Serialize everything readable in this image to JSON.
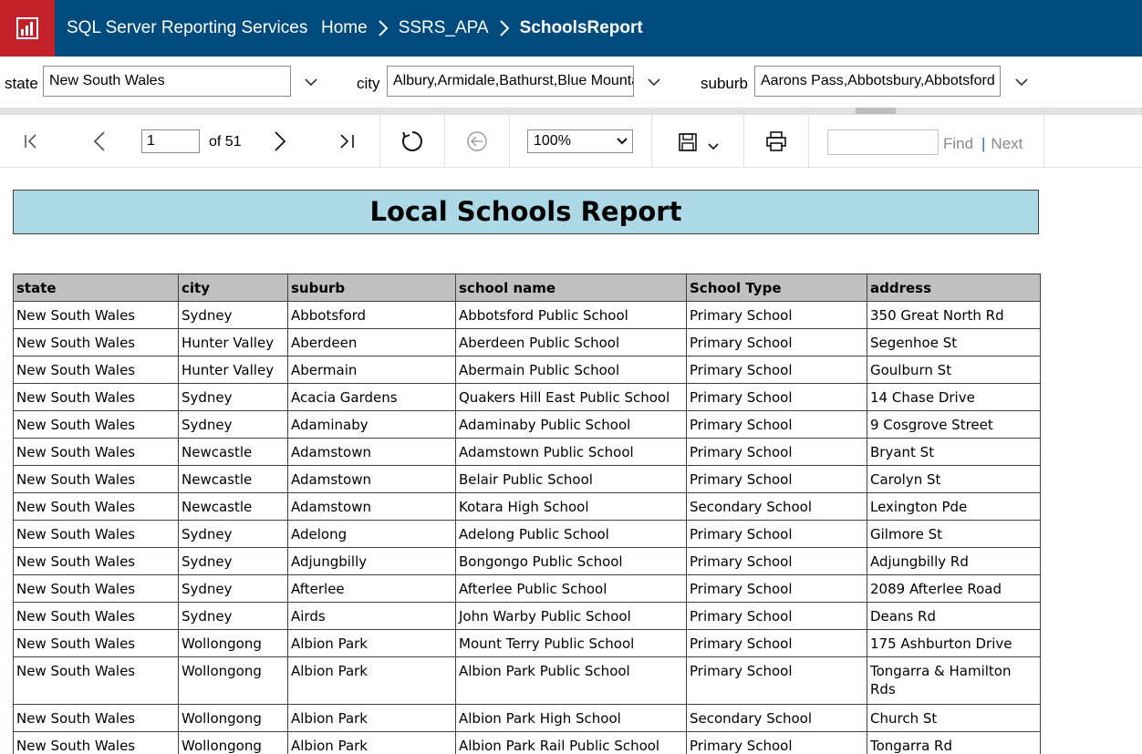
{
  "header": {
    "app_title": "SQL Server Reporting Services",
    "breadcrumbs": [
      "Home",
      "SSRS_APA",
      "SchoolsReport"
    ],
    "brand_color": "#004b7e",
    "logo_color": "#c3222a",
    "logo_icon": "report-logo-icon"
  },
  "parameters": {
    "state": {
      "label": "state",
      "value": "New South Wales"
    },
    "city": {
      "label": "city",
      "value": "Albury,Armidale,Bathurst,Blue Mountains"
    },
    "suburb": {
      "label": "suburb",
      "value": "Aarons Pass,Abbotsbury,Abbotsford"
    }
  },
  "toolbar": {
    "page_value": "1",
    "page_of": "of 51",
    "zoom": "100%",
    "find_label": "Find",
    "next_label": "Next",
    "find_value": ""
  },
  "report": {
    "title": "Local Schools Report",
    "title_bg": "#add8e6",
    "columns": [
      "state",
      "city",
      "suburb",
      "school name",
      "School Type",
      "address"
    ],
    "rows": [
      [
        "New South Wales",
        "Sydney",
        "Abbotsford",
        "Abbotsford Public School",
        "Primary School",
        "350 Great North Rd"
      ],
      [
        "New South Wales",
        "Hunter Valley",
        "Aberdeen",
        "Aberdeen Public School",
        "Primary School",
        "Segenhoe St"
      ],
      [
        "New South Wales",
        "Hunter Valley",
        "Abermain",
        "Abermain Public School",
        "Primary School",
        "Goulburn St"
      ],
      [
        "New South Wales",
        "Sydney",
        "Acacia Gardens",
        "Quakers Hill East Public School",
        "Primary School",
        "14 Chase Drive"
      ],
      [
        "New South Wales",
        "Sydney",
        "Adaminaby",
        "Adaminaby Public School",
        "Primary School",
        "9 Cosgrove Street"
      ],
      [
        "New South Wales",
        "Newcastle",
        "Adamstown",
        "Adamstown Public School",
        "Primary School",
        "Bryant St"
      ],
      [
        "New South Wales",
        "Newcastle",
        "Adamstown",
        "Belair Public School",
        "Primary School",
        "Carolyn St"
      ],
      [
        "New South Wales",
        "Newcastle",
        "Adamstown",
        "Kotara High School",
        "Secondary School",
        "Lexington Pde"
      ],
      [
        "New South Wales",
        "Sydney",
        "Adelong",
        "Adelong Public School",
        "Primary School",
        "Gilmore St"
      ],
      [
        "New South Wales",
        "Sydney",
        "Adjungbilly",
        "Bongongo Public School",
        "Primary School",
        "Adjungbilly Rd"
      ],
      [
        "New South Wales",
        "Sydney",
        "Afterlee",
        "Afterlee Public School",
        "Primary School",
        "2089 Afterlee Road"
      ],
      [
        "New South Wales",
        "Sydney",
        "Airds",
        "John Warby Public School",
        "Primary School",
        "Deans Rd"
      ],
      [
        "New South Wales",
        "Wollongong",
        "Albion Park",
        "Mount Terry Public School",
        "Primary School",
        "175 Ashburton Drive"
      ],
      [
        "New South Wales",
        "Wollongong",
        "Albion Park",
        "Albion Park Public School",
        "Primary School",
        "Tongarra & Hamilton Rds"
      ],
      [
        "New South Wales",
        "Wollongong",
        "Albion Park",
        "Albion Park High School",
        "Secondary School",
        "Church St"
      ],
      [
        "New South Wales",
        "Wollongong",
        "Albion Park",
        "Albion Park Rail Public School",
        "Primary School",
        "Tongarra Rd"
      ]
    ]
  }
}
